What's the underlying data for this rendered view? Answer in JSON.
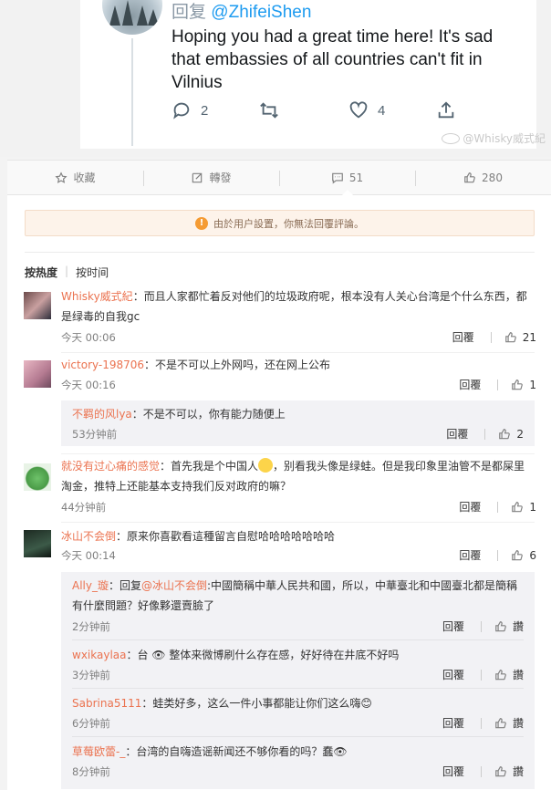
{
  "tweet": {
    "reply_prefix": "回复",
    "reply_handle": "@ZhifeiShen",
    "text": "Hoping you had a great time here! It's sad that embassies of all countries can't fit in Vilnius",
    "actions": [
      {
        "icon": "comment-icon",
        "count": "2"
      },
      {
        "icon": "retweet-icon",
        "count": ""
      },
      {
        "icon": "heart-icon",
        "count": "4"
      },
      {
        "icon": "share-icon",
        "count": ""
      }
    ],
    "watermark": "@Whisky威式紀"
  },
  "stats": [
    {
      "icon": "star-icon",
      "label": "收藏"
    },
    {
      "icon": "forward-icon",
      "label": "轉發"
    },
    {
      "icon": "comment-icon",
      "label": "51"
    },
    {
      "icon": "thumbs-up-icon",
      "label": "280"
    }
  ],
  "notice": "由於用户設置，你無法回覆評論。",
  "sort": {
    "hot": "按热度",
    "time": "按时间"
  },
  "reply_label": "回覆",
  "comments": [
    {
      "user": "Whisky威式紀",
      "text": "：而且人家都忙着反对他们的垃圾政府呢，根本没有人关心台湾是个什么东西，都是绿毒的自我gc",
      "time": "今天 00:06",
      "likes": "21"
    },
    {
      "user": "victory-198706",
      "text": "：不是不可以上外网吗，还在网上公布",
      "time": "今天 00:16",
      "likes": "1",
      "replies": [
        {
          "user": "不羁的风lya",
          "text": "：不是不可以，你有能力随便上",
          "time": "53分钟前",
          "likes": "2"
        }
      ]
    },
    {
      "user": "就没有过心痛的感觉",
      "text": "：首先我是个中国人",
      "text2": "，别看我头像是绿蛙。但是我印象里油管不是都屎里淘金，推特上还能基本支持我们反对政府的嘛？",
      "time": "44分钟前",
      "likes": "1"
    },
    {
      "user": "冰山不会倒",
      "text": "：原来你喜歡看這種留言自慰哈哈哈哈哈哈哈",
      "time": "今天 00:14",
      "likes": "6",
      "replies": [
        {
          "user": "Ally_璇",
          "text": "：回复",
          "mention": "@冰山不会倒",
          "text2": ":中國簡稱中華人民共和國，所以，中華臺北和中國臺北都是簡稱有什麼問題？好像夥還賣臉了",
          "time": "2分钟前",
          "likes": "讚"
        },
        {
          "user": "wxikaylaa",
          "text": "：台 👁 整体来微博刷什么存在感，好好待在井底不好吗",
          "time": "3分钟前",
          "likes": "讚"
        },
        {
          "user": "Sabrina5111",
          "text": "：蛙类好多，这么一件小事都能让你们这么嗨😊",
          "time": "6分钟前",
          "likes": "讚"
        },
        {
          "user": "草莓欧蕾-_",
          "text": "：台湾的自嗨造谣新闻还不够你看的吗？蠢👁",
          "time": "8分钟前",
          "likes": "讚"
        }
      ]
    }
  ]
}
